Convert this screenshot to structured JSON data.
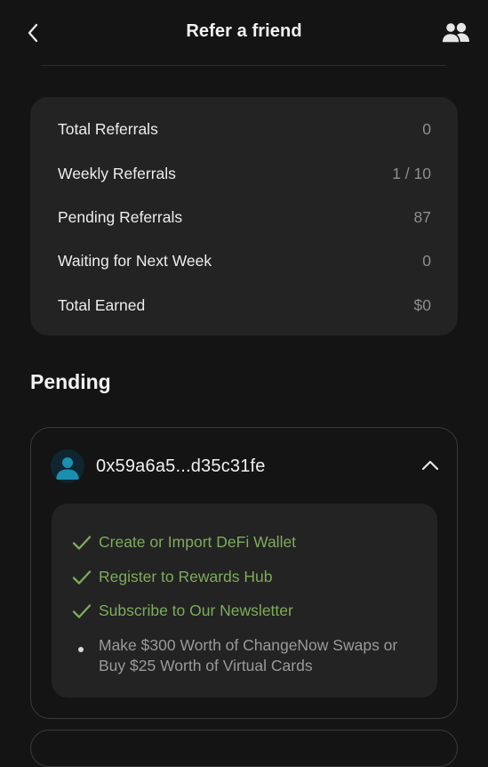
{
  "header": {
    "title": "Refer a friend",
    "back_icon": "chevron-left-icon",
    "users_icon": "users-icon"
  },
  "stats": [
    {
      "label": "Total Referrals",
      "value": "0"
    },
    {
      "label": "Weekly Referrals",
      "value": "1 / 10"
    },
    {
      "label": "Pending Referrals",
      "value": "87"
    },
    {
      "label": "Waiting for Next Week",
      "value": "0"
    },
    {
      "label": "Total Earned",
      "value": "$0"
    }
  ],
  "pending": {
    "title": "Pending",
    "referral": {
      "address": "0x59a6a5...d35c31fe",
      "avatar_icon": "user-avatar-icon",
      "collapse_icon": "chevron-up-icon",
      "tasks": [
        {
          "label": "Create or Import DeFi Wallet",
          "done": true
        },
        {
          "label": "Register to Rewards Hub",
          "done": true
        },
        {
          "label": "Subscribe to Our Newsletter",
          "done": true
        },
        {
          "label": "Make $300 Worth of ChangeNow Swaps or Buy $25 Worth of Virtual Cards",
          "done": false
        }
      ]
    }
  },
  "colors": {
    "background": "#141414",
    "card": "#232323",
    "done_green": "#7dac5a",
    "muted": "#8e8e8e"
  }
}
